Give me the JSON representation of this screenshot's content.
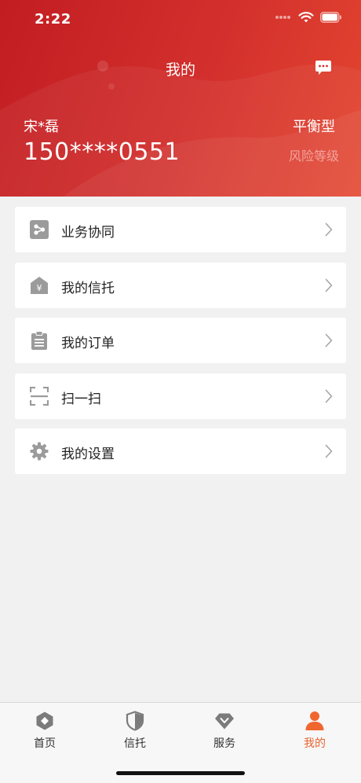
{
  "status_bar": {
    "time": "2:22"
  },
  "header": {
    "title": "我的",
    "user_name": "宋*磊",
    "phone": "150****0551",
    "risk_type": "平衡型",
    "risk_label": "风险等级"
  },
  "menu": {
    "items": [
      {
        "label": "业务协同",
        "icon": "business-collab-icon"
      },
      {
        "label": "我的信托",
        "icon": "trust-icon"
      },
      {
        "label": "我的订单",
        "icon": "clipboard-icon"
      },
      {
        "label": "扫一扫",
        "icon": "scan-icon"
      },
      {
        "label": "我的设置",
        "icon": "gear-icon"
      }
    ]
  },
  "tabbar": {
    "tabs": [
      {
        "label": "首页",
        "icon": "home-icon"
      },
      {
        "label": "信托",
        "icon": "shield-icon"
      },
      {
        "label": "服务",
        "icon": "diamond-icon"
      },
      {
        "label": "我的",
        "icon": "person-icon"
      }
    ],
    "active_color": "#e8632f"
  }
}
